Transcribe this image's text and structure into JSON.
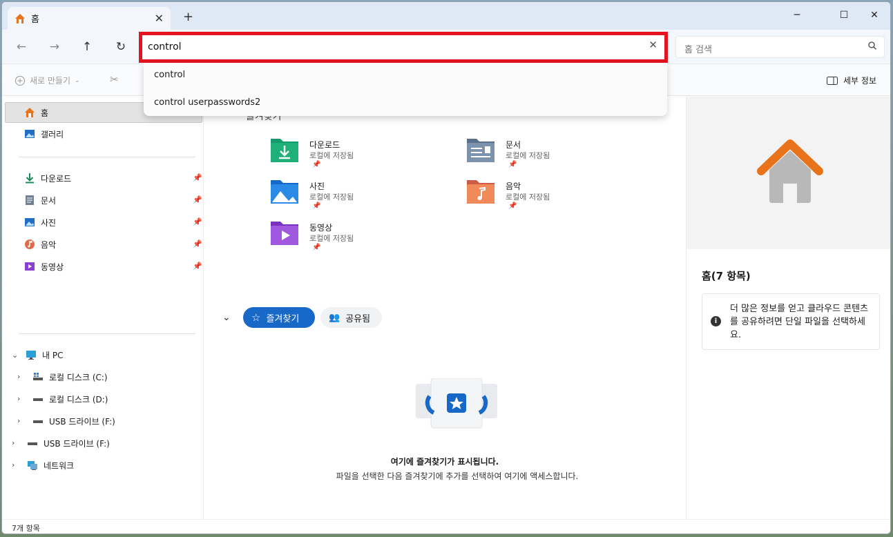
{
  "tab": {
    "title": "홈",
    "close": "✕",
    "new_tab": "+"
  },
  "window_controls": {
    "minimize": "─",
    "maximize": "☐",
    "close": "✕"
  },
  "nav": {
    "back": "←",
    "forward": "→",
    "up": "↑",
    "refresh": "↻"
  },
  "address": {
    "value": "control",
    "clear": "✕"
  },
  "search": {
    "placeholder": "홈 검색"
  },
  "suggestions": [
    "control",
    "control userpasswords2"
  ],
  "toolbar": {
    "new_label": "새로 만들기",
    "details_label": "세부 정보"
  },
  "sidebar": {
    "home": "홈",
    "gallery": "갤러리",
    "pinned": [
      {
        "label": "다운로드"
      },
      {
        "label": "문서"
      },
      {
        "label": "사진"
      },
      {
        "label": "음악"
      },
      {
        "label": "동영상"
      }
    ],
    "this_pc": "내 PC",
    "drives": [
      {
        "label": "로컬 디스크 (C:)"
      },
      {
        "label": "로컬 디스크 (D:)"
      },
      {
        "label": "USB 드라이브 (F:)"
      }
    ],
    "usb_top": "USB 드라이브 (F:)",
    "network": "네트워크"
  },
  "main": {
    "quick_access_title": "즐겨찾기",
    "folders": [
      {
        "name": "다운로드",
        "sub": "로컬에 저장됨",
        "icon": "download-folder-icon"
      },
      {
        "name": "문서",
        "sub": "로컬에 저장됨",
        "icon": "documents-folder-icon"
      },
      {
        "name": "사진",
        "sub": "로컬에 저장됨",
        "icon": "pictures-folder-icon"
      },
      {
        "name": "음악",
        "sub": "로컬에 저장됨",
        "icon": "music-folder-icon"
      },
      {
        "name": "동영상",
        "sub": "로컬에 저장됨",
        "icon": "videos-folder-icon"
      }
    ],
    "tabs": {
      "favorites": "즐겨찾기",
      "shared": "공유됨"
    },
    "empty_title": "여기에 즐겨찾기가 표시됩니다.",
    "empty_desc": "파일을 선택한 다음 즐겨찾기에 추가를 선택하여 여기에 액세스합니다."
  },
  "details": {
    "title": "홈(7 항목)",
    "info": "더 많은 정보를 얻고 클라우드 콘텐츠를 공유하려면 단일 파일을 선택하세요."
  },
  "status": {
    "count": "7개 항목"
  },
  "colors": {
    "accent": "#1868c8",
    "highlight": "#e3141f"
  }
}
